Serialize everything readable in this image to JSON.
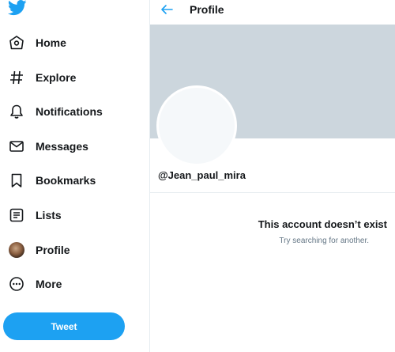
{
  "app": {
    "logo_icon": "twitter-bird-icon",
    "brand_color": "#1da1f2"
  },
  "sidebar": {
    "items": [
      {
        "label": "Home",
        "icon": "home-icon"
      },
      {
        "label": "Explore",
        "icon": "hashtag-icon"
      },
      {
        "label": "Notifications",
        "icon": "bell-icon"
      },
      {
        "label": "Messages",
        "icon": "envelope-icon"
      },
      {
        "label": "Bookmarks",
        "icon": "bookmark-icon"
      },
      {
        "label": "Lists",
        "icon": "list-icon"
      },
      {
        "label": "Profile",
        "icon": "avatar"
      },
      {
        "label": "More",
        "icon": "more-circle-icon"
      }
    ],
    "tweet_label": "Tweet"
  },
  "header": {
    "back_icon": "back-arrow-icon",
    "title": "Profile"
  },
  "profile": {
    "banner_color": "#ccd6dd",
    "handle": "@Jean_paul_mira"
  },
  "empty_state": {
    "title": "This account doesn’t exist",
    "subtitle": "Try searching for another."
  }
}
